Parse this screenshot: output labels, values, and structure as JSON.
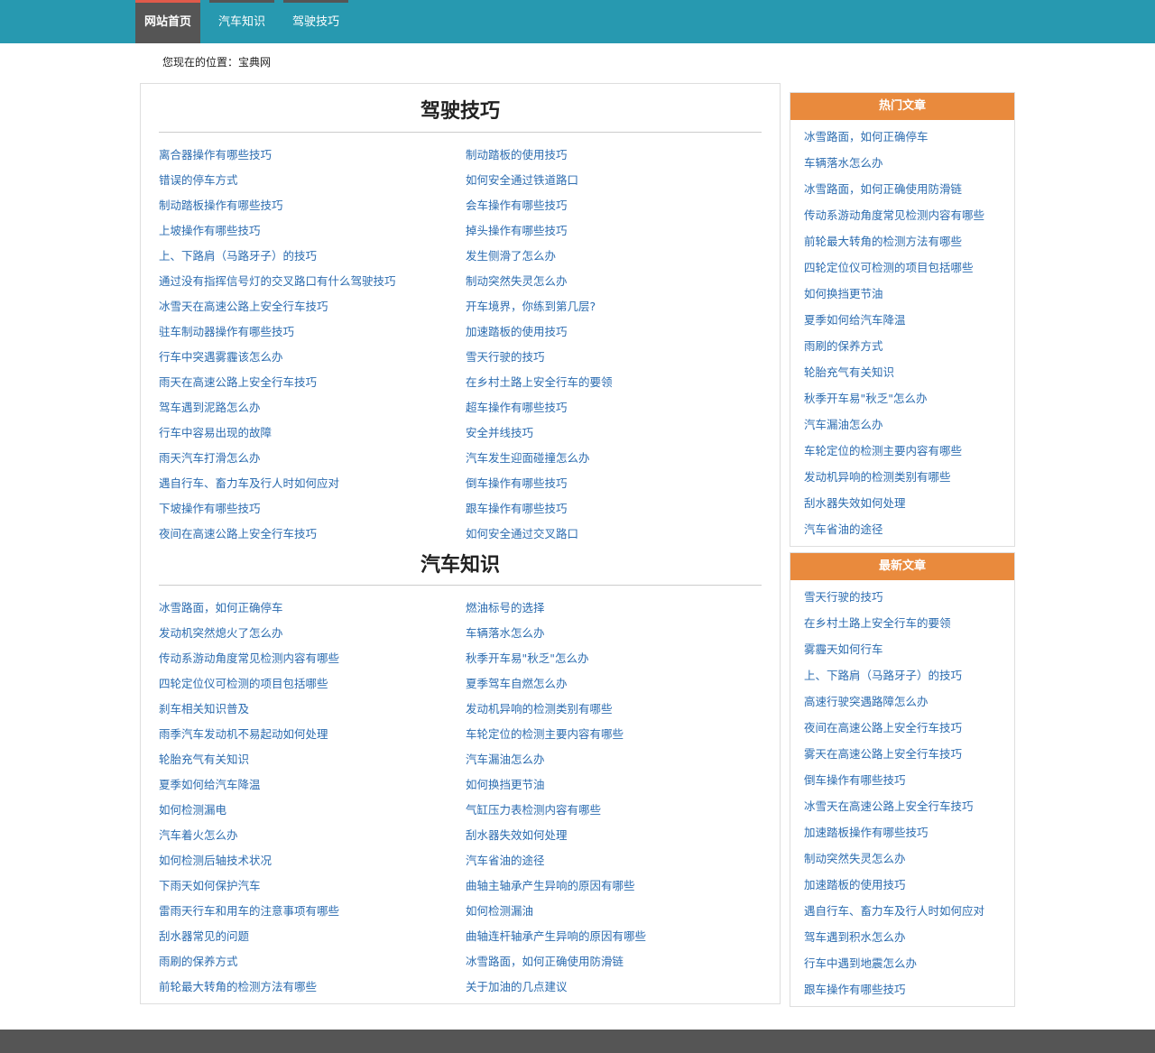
{
  "nav": {
    "items": [
      {
        "label": "网站首页"
      },
      {
        "label": "汽车知识"
      },
      {
        "label": "驾驶技巧"
      }
    ]
  },
  "breadcrumb": {
    "prefix": "您现在的位置：",
    "site": "宝典网"
  },
  "sections": [
    {
      "title": "驾驶技巧",
      "left": [
        "离合器操作有哪些技巧",
        "错误的停车方式",
        "制动踏板操作有哪些技巧",
        "上坡操作有哪些技巧",
        "上、下路肩（马路牙子）的技巧",
        "通过没有指挥信号灯的交叉路口有什么驾驶技巧",
        "冰雪天在高速公路上安全行车技巧",
        "驻车制动器操作有哪些技巧",
        "行车中突遇雾霾该怎么办",
        "雨天在高速公路上安全行车技巧",
        "驾车遇到泥路怎么办",
        "行车中容易出现的故障",
        "雨天汽车打滑怎么办",
        "遇自行车、畜力车及行人时如何应对",
        "下坡操作有哪些技巧",
        "夜间在高速公路上安全行车技巧"
      ],
      "right": [
        "制动踏板的使用技巧",
        "如何安全通过铁道路口",
        "会车操作有哪些技巧",
        "掉头操作有哪些技巧",
        "发生侧滑了怎么办",
        "制动突然失灵怎么办",
        "开车境界，你练到第几层?",
        "加速踏板的使用技巧",
        "雪天行驶的技巧",
        "在乡村土路上安全行车的要领",
        "超车操作有哪些技巧",
        "安全并线技巧",
        "汽车发生迎面碰撞怎么办",
        "倒车操作有哪些技巧",
        "跟车操作有哪些技巧",
        "如何安全通过交叉路口"
      ]
    },
    {
      "title": "汽车知识",
      "left": [
        "冰雪路面，如何正确停车",
        "发动机突然熄火了怎么办",
        "传动系游动角度常见检测内容有哪些",
        "四轮定位仪可检测的项目包括哪些",
        "刹车相关知识普及",
        "雨季汽车发动机不易起动如何处理",
        "轮胎充气有关知识",
        "夏季如何给汽车降温",
        "如何检测漏电",
        "汽车着火怎么办",
        "如何检测后轴技术状况",
        "下雨天如何保护汽车",
        "雷雨天行车和用车的注意事项有哪些",
        "刮水器常见的问题",
        "雨刷的保养方式",
        "前轮最大转角的检测方法有哪些"
      ],
      "right": [
        "燃油标号的选择",
        "车辆落水怎么办",
        "秋季开车易\"秋乏\"怎么办",
        "夏季驾车自燃怎么办",
        "发动机异响的检测类别有哪些",
        "车轮定位的检测主要内容有哪些",
        "汽车漏油怎么办",
        "如何换挡更节油",
        "气缸压力表检测内容有哪些",
        "刮水器失效如何处理",
        "汽车省油的途径",
        "曲轴主轴承产生异响的原因有哪些",
        "如何检测漏油",
        "曲轴连杆轴承产生异响的原因有哪些",
        "冰雪路面，如何正确使用防滑链",
        "关于加油的几点建议"
      ]
    }
  ],
  "sidebar": {
    "hot": {
      "title": "热门文章",
      "items": [
        "冰雪路面，如何正确停车",
        "车辆落水怎么办",
        "冰雪路面，如何正确使用防滑链",
        "传动系游动角度常见检测内容有哪些",
        "前轮最大转角的检测方法有哪些",
        "四轮定位仪可检测的项目包括哪些",
        "如何换挡更节油",
        "夏季如何给汽车降温",
        "雨刷的保养方式",
        "轮胎充气有关知识",
        "秋季开车易\"秋乏\"怎么办",
        "汽车漏油怎么办",
        "车轮定位的检测主要内容有哪些",
        "发动机异响的检测类别有哪些",
        "刮水器失效如何处理",
        "汽车省油的途径"
      ]
    },
    "latest": {
      "title": "最新文章",
      "items": [
        "雪天行驶的技巧",
        "在乡村土路上安全行车的要领",
        "雾霾天如何行车",
        "上、下路肩（马路牙子）的技巧",
        "高速行驶突遇路障怎么办",
        "夜间在高速公路上安全行车技巧",
        "雾天在高速公路上安全行车技巧",
        "倒车操作有哪些技巧",
        "冰雪天在高速公路上安全行车技巧",
        "加速踏板操作有哪些技巧",
        "制动突然失灵怎么办",
        "加速踏板的使用技巧",
        "遇自行车、畜力车及行人时如何应对",
        "驾车遇到积水怎么办",
        "行车中遇到地震怎么办",
        "跟车操作有哪些技巧"
      ]
    }
  },
  "colors": {
    "nav_bg": "#2799b0",
    "nav_active": "#555555",
    "accent": "#e98a3d",
    "link": "#2b6cb0"
  }
}
